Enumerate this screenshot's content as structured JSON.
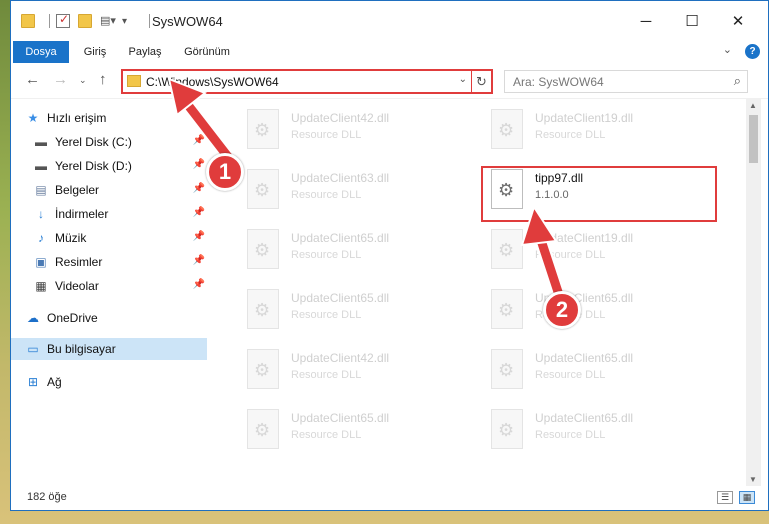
{
  "window": {
    "title": "SysWOW64"
  },
  "ribbon": {
    "tabs": [
      "Dosya",
      "Giriş",
      "Paylaş",
      "Görünüm"
    ],
    "active_tab": "Dosya"
  },
  "address": {
    "path": "C:\\Windows\\SysWOW64",
    "search_placeholder": "Ara: SysWOW64"
  },
  "sidebar": {
    "items": [
      {
        "label": "Hızlı erişim",
        "icon": "star-icon"
      },
      {
        "label": "Yerel Disk (C:)",
        "icon": "drive-icon",
        "pinned": true
      },
      {
        "label": "Yerel Disk (D:)",
        "icon": "drive-icon",
        "pinned": true
      },
      {
        "label": "Belgeler",
        "icon": "documents-icon",
        "pinned": true
      },
      {
        "label": "İndirmeler",
        "icon": "download-icon",
        "pinned": true
      },
      {
        "label": "Müzik",
        "icon": "music-icon",
        "pinned": true
      },
      {
        "label": "Resimler",
        "icon": "pictures-icon",
        "pinned": true
      },
      {
        "label": "Videolar",
        "icon": "video-icon",
        "pinned": true
      },
      {
        "label": "OneDrive",
        "icon": "cloud-icon"
      },
      {
        "label": "Bu bilgisayar",
        "icon": "computer-icon",
        "selected": true
      },
      {
        "label": "Ağ",
        "icon": "network-icon"
      }
    ]
  },
  "files": [
    {
      "name": "UpdateClient42.dll",
      "sub": "Resource DLL"
    },
    {
      "name": "UpdateClient19.dll",
      "sub": "Resource DLL"
    },
    {
      "name": "UpdateClient63.dll",
      "sub": "Resource DLL"
    },
    {
      "name": "tipp97.dll",
      "sub": "1.1.0.0",
      "highlighted": true
    },
    {
      "name": "UpdateClient65.dll",
      "sub": "Resource DLL"
    },
    {
      "name": "UpdateClient19.dll",
      "sub": "Resource DLL"
    },
    {
      "name": "UpdateClient65.dll",
      "sub": "Resource DLL"
    },
    {
      "name": "UpdateClient65.dll",
      "sub": "Resource DLL"
    },
    {
      "name": "UpdateClient42.dll",
      "sub": "Resource DLL"
    },
    {
      "name": "UpdateClient65.dll",
      "sub": "Resource DLL"
    },
    {
      "name": "UpdateClient65.dll",
      "sub": "Resource DLL"
    },
    {
      "name": "UpdateClient65.dll",
      "sub": "Resource DLL"
    }
  ],
  "status": {
    "count_text": "182 öğe"
  },
  "annotations": {
    "badge1": "1",
    "badge2": "2",
    "color": "#e03c3c"
  }
}
